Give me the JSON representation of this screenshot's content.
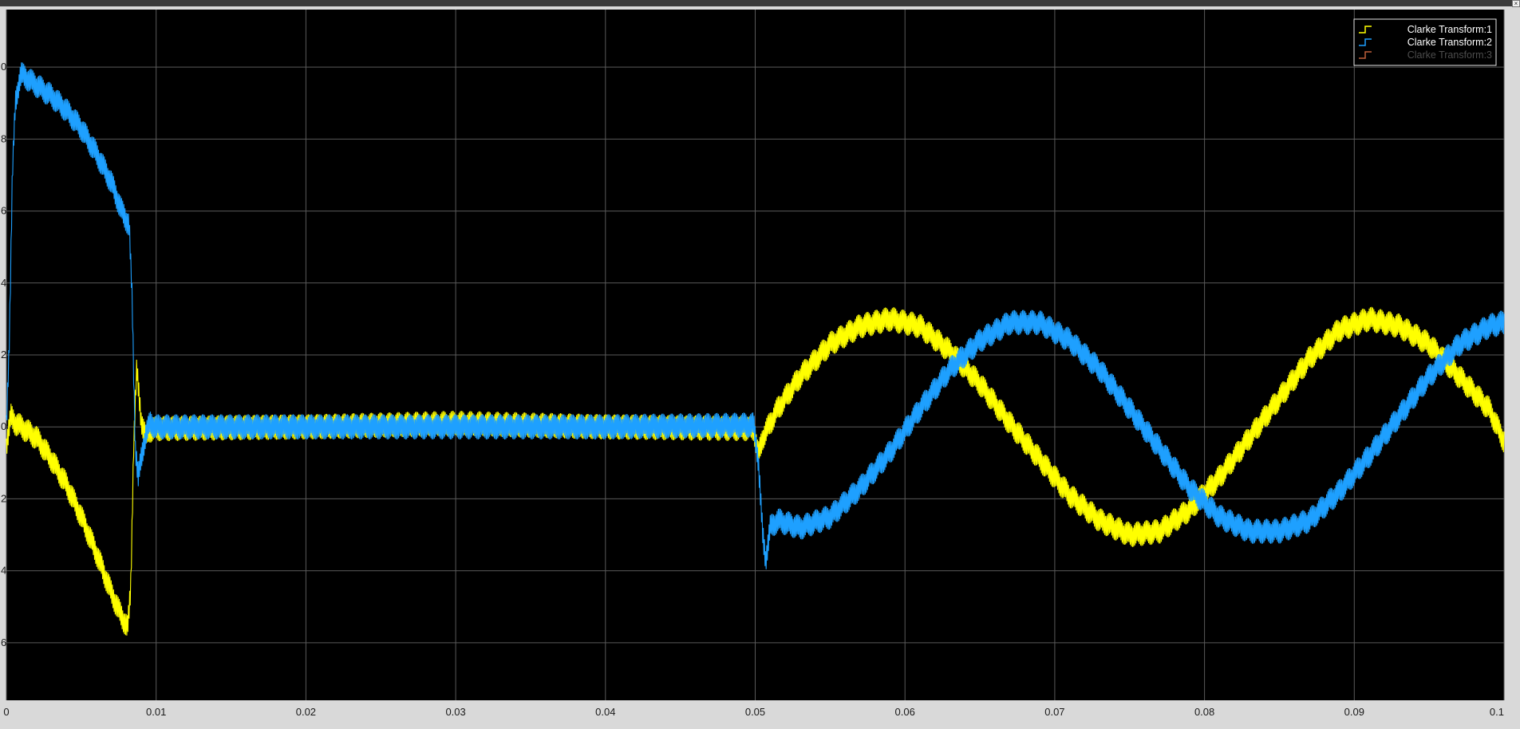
{
  "window": {
    "corner_button_glyph": "×"
  },
  "colors": {
    "background": "#000000",
    "grid": "#5a5a5a",
    "axis_text": "#1a1a1a",
    "frame": "#d9d9d9",
    "legend_border": "#e6e6e6"
  },
  "chart_data": {
    "type": "line",
    "title": "",
    "xlabel": "",
    "ylabel": "",
    "xlim": [
      0,
      0.1
    ],
    "ylim": [
      -7.6,
      11.6
    ],
    "grid": true,
    "legend_position": "top-right",
    "x_ticks": [
      0,
      0.01,
      0.02,
      0.03,
      0.04,
      0.05,
      0.06,
      0.07,
      0.08,
      0.09,
      0.1
    ],
    "x_tick_labels": [
      "0",
      "0.01",
      "0.02",
      "0.03",
      "0.04",
      "0.05",
      "0.06",
      "0.07",
      "0.08",
      "0.09",
      "0.1"
    ],
    "y_ticks": [
      10,
      8,
      6,
      4,
      2,
      0,
      -2,
      -4,
      -6
    ],
    "y_tick_labels": [
      "0",
      "8",
      "6",
      "4",
      "2",
      "0",
      "2",
      "4",
      "6"
    ],
    "series": [
      {
        "name": "Clarke Transform:1",
        "color": "#ffff00",
        "ripple": 0.35,
        "points": [
          [
            0,
            -0.5
          ],
          [
            0.0003,
            0.3
          ],
          [
            0.0006,
            0.1
          ],
          [
            0.001,
            0
          ],
          [
            0.002,
            -0.3
          ],
          [
            0.003,
            -0.9
          ],
          [
            0.004,
            -1.6
          ],
          [
            0.005,
            -2.5
          ],
          [
            0.006,
            -3.5
          ],
          [
            0.007,
            -4.6
          ],
          [
            0.0075,
            -5.1
          ],
          [
            0.0081,
            -5.6
          ],
          [
            0.0083,
            -4.5
          ],
          [
            0.0085,
            -0.5
          ],
          [
            0.0087,
            1.6
          ],
          [
            0.009,
            0.2
          ],
          [
            0.0093,
            -0.3
          ],
          [
            0.0095,
            -0.1
          ],
          [
            0.01,
            -0.05
          ],
          [
            0.02,
            0
          ],
          [
            0.03,
            0.1
          ],
          [
            0.04,
            0
          ],
          [
            0.0499,
            -0.05
          ],
          [
            0.0502,
            -0.8
          ],
          [
            0.0505,
            -0.3
          ],
          [
            0.0515,
            0.5
          ],
          [
            0.053,
            1.4
          ],
          [
            0.055,
            2.3
          ],
          [
            0.057,
            2.8
          ],
          [
            0.059,
            3.0
          ],
          [
            0.061,
            2.8
          ],
          [
            0.063,
            2.1
          ],
          [
            0.065,
            1.2
          ],
          [
            0.067,
            0.1
          ],
          [
            0.069,
            -0.9
          ],
          [
            0.071,
            -1.9
          ],
          [
            0.073,
            -2.6
          ],
          [
            0.075,
            -3.0
          ],
          [
            0.077,
            -2.9
          ],
          [
            0.079,
            -2.3
          ],
          [
            0.081,
            -1.4
          ],
          [
            0.083,
            -0.3
          ],
          [
            0.085,
            0.8
          ],
          [
            0.087,
            1.9
          ],
          [
            0.089,
            2.7
          ],
          [
            0.091,
            3.0
          ],
          [
            0.093,
            2.8
          ],
          [
            0.095,
            2.3
          ],
          [
            0.097,
            1.4
          ],
          [
            0.099,
            0.5
          ],
          [
            0.1,
            -0.4
          ]
        ]
      },
      {
        "name": "Clarke Transform:2",
        "color": "#1ea0ff",
        "ripple": 0.35,
        "points": [
          [
            0,
            0
          ],
          [
            0.0002,
            2.5
          ],
          [
            0.0004,
            7.0
          ],
          [
            0.0006,
            9.0
          ],
          [
            0.0009,
            9.7
          ],
          [
            0.001,
            9.8
          ],
          [
            0.002,
            9.5
          ],
          [
            0.003,
            9.2
          ],
          [
            0.004,
            8.8
          ],
          [
            0.005,
            8.3
          ],
          [
            0.006,
            7.6
          ],
          [
            0.007,
            6.8
          ],
          [
            0.0077,
            6.0
          ],
          [
            0.0082,
            5.6
          ],
          [
            0.0084,
            3.5
          ],
          [
            0.0086,
            -0.5
          ],
          [
            0.0088,
            -1.4
          ],
          [
            0.009,
            -0.9
          ],
          [
            0.0093,
            -0.2
          ],
          [
            0.0096,
            0.1
          ],
          [
            0.01,
            0
          ],
          [
            0.02,
            0
          ],
          [
            0.03,
            0
          ],
          [
            0.04,
            0
          ],
          [
            0.0499,
            0.05
          ],
          [
            0.0502,
            -0.9
          ],
          [
            0.0505,
            -3.0
          ],
          [
            0.0507,
            -3.7
          ],
          [
            0.051,
            -2.8
          ],
          [
            0.0515,
            -2.6
          ],
          [
            0.053,
            -2.8
          ],
          [
            0.055,
            -2.5
          ],
          [
            0.057,
            -1.7
          ],
          [
            0.059,
            -0.7
          ],
          [
            0.061,
            0.5
          ],
          [
            0.063,
            1.6
          ],
          [
            0.065,
            2.4
          ],
          [
            0.067,
            2.9
          ],
          [
            0.069,
            2.9
          ],
          [
            0.071,
            2.4
          ],
          [
            0.073,
            1.6
          ],
          [
            0.075,
            0.5
          ],
          [
            0.077,
            -0.6
          ],
          [
            0.079,
            -1.7
          ],
          [
            0.081,
            -2.5
          ],
          [
            0.083,
            -2.9
          ],
          [
            0.085,
            -2.9
          ],
          [
            0.087,
            -2.6
          ],
          [
            0.089,
            -1.8
          ],
          [
            0.091,
            -0.8
          ],
          [
            0.093,
            0.3
          ],
          [
            0.095,
            1.4
          ],
          [
            0.097,
            2.3
          ],
          [
            0.099,
            2.8
          ],
          [
            0.1,
            2.9
          ]
        ]
      },
      {
        "name": "Clarke Transform:3",
        "color": "#c0613a",
        "ripple": 0,
        "points": []
      }
    ]
  }
}
